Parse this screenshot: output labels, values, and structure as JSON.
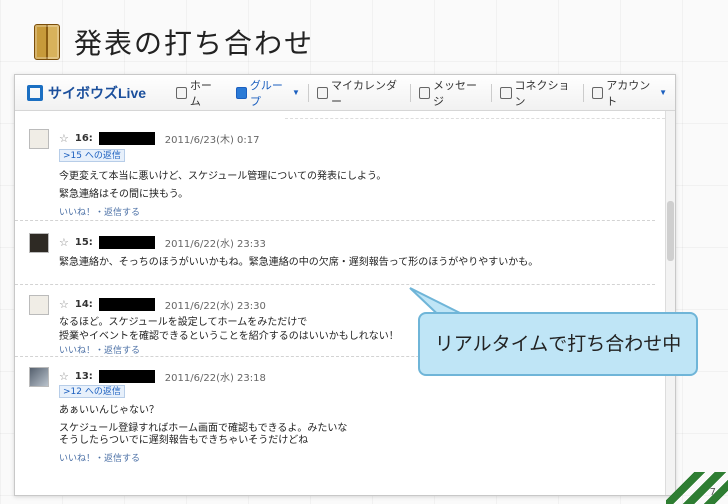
{
  "slide": {
    "title": "発表の打ち合わせ",
    "page_number": "7"
  },
  "app": {
    "logo": "サイボウズLive",
    "nav": [
      {
        "label": "ホーム"
      },
      {
        "label": "グループ"
      },
      {
        "label": "マイカレンダー"
      },
      {
        "label": "メッセージ"
      },
      {
        "label": "コネクション"
      },
      {
        "label": "アカウント"
      }
    ]
  },
  "posts": [
    {
      "number": "16:",
      "date": "2011/6/23(木) 0:17",
      "reply_to": ">15 への返信",
      "lines": [
        "今更変えて本当に悪いけど、スケジュール管理についての発表にしよう。",
        "緊急連絡はその間に挟もう。"
      ],
      "actions": "いいね！・返信する"
    },
    {
      "number": "15:",
      "date": "2011/6/22(水) 23:33",
      "reply_to": "",
      "lines": [
        "緊急連絡か、そっちのほうがいいかもね。緊急連絡の中の欠席・遅刻報告って形のほうがやりやすいかも。"
      ],
      "actions": ""
    },
    {
      "number": "14:",
      "date": "2011/6/22(水) 23:30",
      "reply_to": "",
      "lines": [
        "なるほど。スケジュールを設定してホームをみただけで",
        "授業やイベントを確認できるということを紹介するのはいいかもしれない！"
      ],
      "actions": "いいね！・返信する"
    },
    {
      "number": "13:",
      "date": "2011/6/22(水) 23:18",
      "reply_to": ">12 への返信",
      "lines": [
        "あぁいいんじゃない？",
        "スケジュール登録すればホーム画面で確認もできるよ。みたいな",
        "そうしたらついでに遅刻報告もできちゃいそうだけどね"
      ],
      "actions": "いいね！・返信する"
    }
  ],
  "callout": {
    "text": "リアルタイムで打ち合わせ中"
  }
}
